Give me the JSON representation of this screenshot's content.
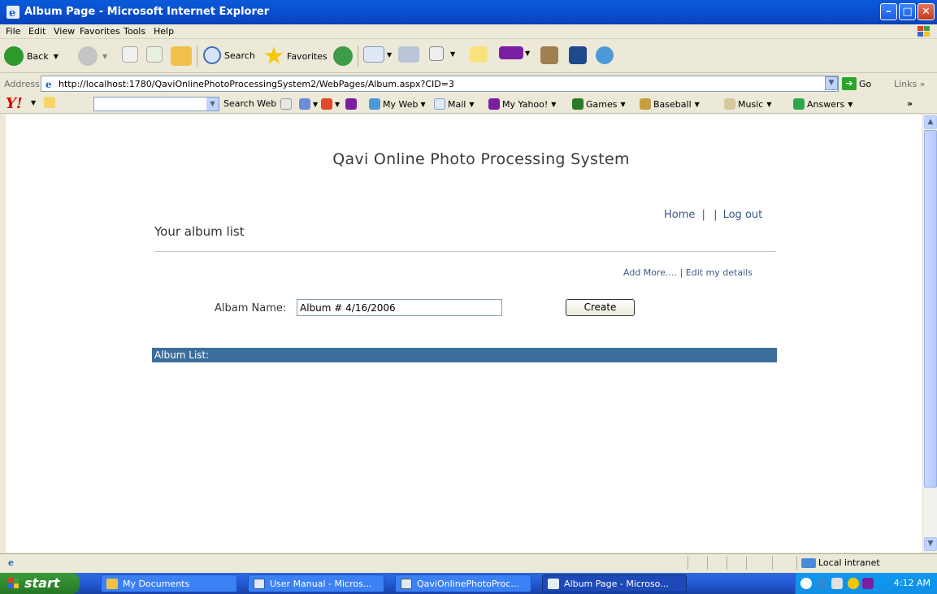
{
  "window": {
    "title": "Album Page - Microsoft Internet Explorer"
  },
  "menu": {
    "items": [
      "File",
      "Edit",
      "View",
      "Favorites",
      "Tools",
      "Help"
    ]
  },
  "toolbar": {
    "back_label": "Back",
    "search_label": "Search",
    "favorites_label": "Favorites"
  },
  "address": {
    "label": "Address",
    "url": "http://localhost:1780/QaviOnlinePhotoProcessingSystem2/WebPages/Album.aspx?CID=3",
    "go_label": "Go",
    "links_label": "Links"
  },
  "yahoo_toolbar": {
    "search_web_label": "Search Web",
    "items": [
      "My Web",
      "Mail",
      "My Yahoo!",
      "Games",
      "Baseball",
      "Music",
      "Answers"
    ]
  },
  "page": {
    "site_title": "Qavi Online Photo Processing System",
    "nav_home": "Home",
    "nav_sep1": "|",
    "nav_sep2": "|",
    "nav_logout": "Log out",
    "heading": "Your album list",
    "add_more": "Add More....",
    "actions_sep": "|",
    "edit_details": "Edit my details",
    "album_name_label": "Albam Name:",
    "album_name_value": "Album # 4/16/2006",
    "create_label": "Create",
    "list_header": "Album List:"
  },
  "status": {
    "zone": "Local intranet"
  },
  "taskbar": {
    "start_label": "start",
    "tasks": [
      "My Documents",
      "User Manual - Micros...",
      "QaviOnlinePhotoProc...",
      "Album Page - Microso..."
    ],
    "clock": "4:12 AM"
  },
  "colors": {
    "title_bar": "#0a4fd0",
    "list_header_bg": "#3c6e9b",
    "link": "#3a5a8a",
    "start_button": "#2f8a2f"
  }
}
